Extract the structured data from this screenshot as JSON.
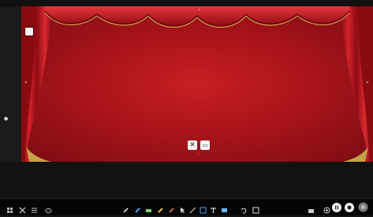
{
  "stage": {
    "background_color": "#b3161c",
    "curtain_color": "#c8151c",
    "valance_color": "#d11a22"
  },
  "controls": {
    "close_icon": "close-icon",
    "slide_icon": "slide-icon"
  },
  "taskbar": {
    "left_icons": [
      "tool-icon",
      "tool-icon",
      "tool-icon",
      "tool-icon"
    ],
    "center_icons": [
      "tool-icon",
      "tool-icon",
      "tool-icon",
      "tool-icon",
      "tool-icon",
      "tool-icon",
      "tool-icon",
      "tool-icon",
      "tool-icon",
      "tool-icon",
      "tool-icon",
      "tool-icon"
    ],
    "right_icons": [
      "tool-icon",
      "tool-icon",
      "tool-icon",
      "tool-icon",
      "tool-icon"
    ]
  }
}
